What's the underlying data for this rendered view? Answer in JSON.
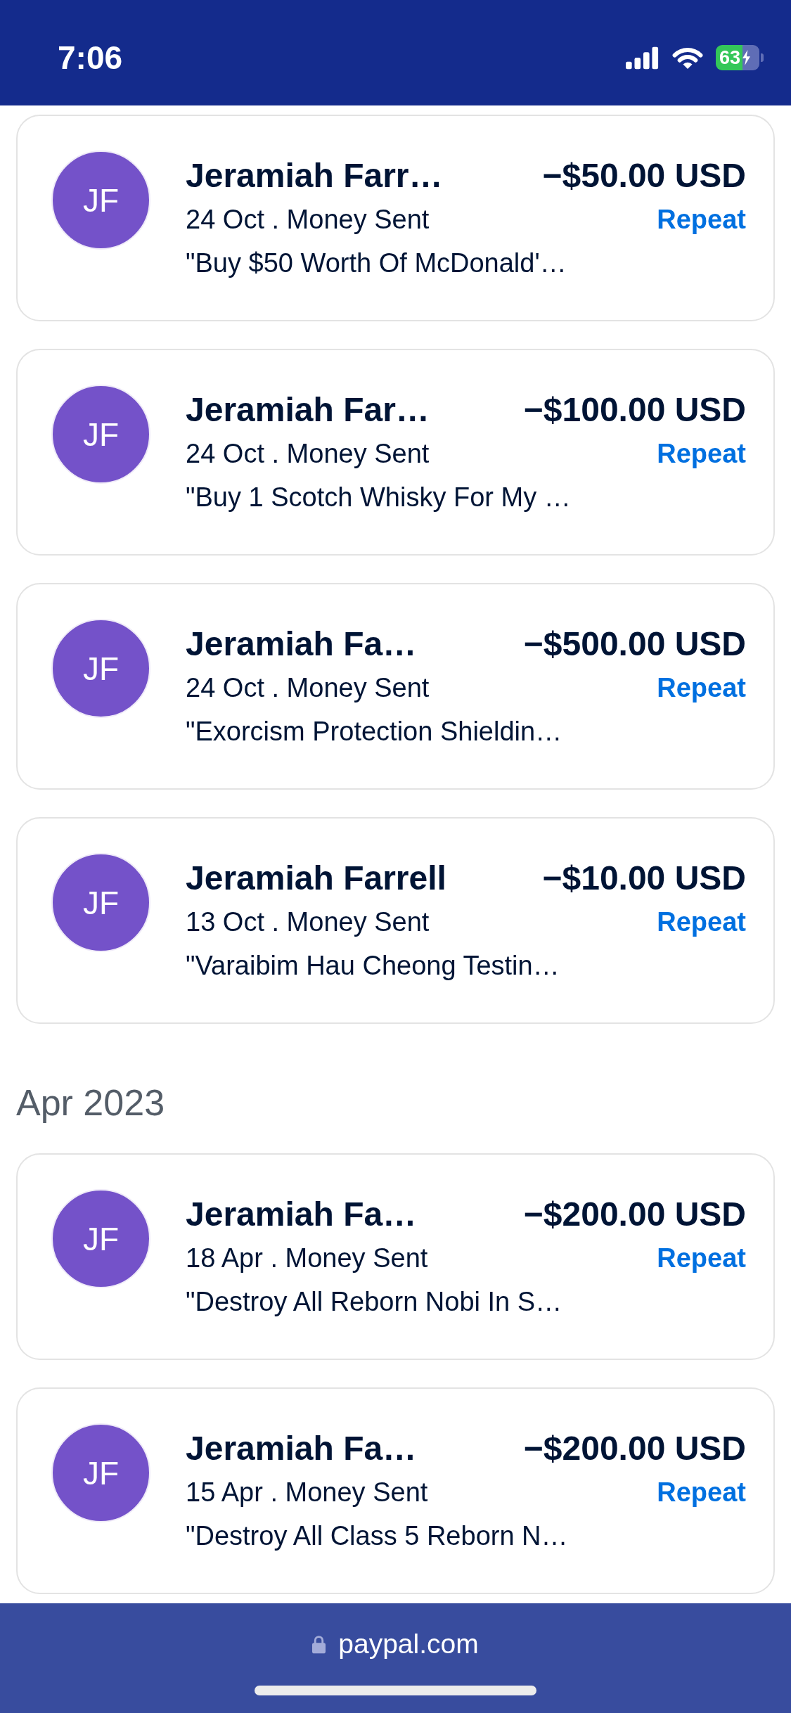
{
  "status_bar": {
    "time": "7:06",
    "battery": "63"
  },
  "sections": [
    {
      "transactions": [
        {
          "initials": "JF",
          "name": "Jeramiah Farr…",
          "amount": "−$50.00 USD",
          "details": "24 Oct . Money Sent",
          "action": "Repeat",
          "note": "\"Buy $50 Worth Of McDonald'…"
        },
        {
          "initials": "JF",
          "name": "Jeramiah Far…",
          "amount": "−$100.00 USD",
          "details": "24 Oct . Money Sent",
          "action": "Repeat",
          "note": "\"Buy 1 Scotch Whisky For My …"
        },
        {
          "initials": "JF",
          "name": "Jeramiah Fa…",
          "amount": "−$500.00 USD",
          "details": "24 Oct . Money Sent",
          "action": "Repeat",
          "note": "\"Exorcism Protection Shieldin…"
        },
        {
          "initials": "JF",
          "name": "Jeramiah Farrell",
          "amount": "−$10.00 USD",
          "details": "13 Oct . Money Sent",
          "action": "Repeat",
          "note": "\"Varaibim Hau Cheong Testin…"
        }
      ]
    },
    {
      "heading": "Apr 2023",
      "transactions": [
        {
          "initials": "JF",
          "name": "Jeramiah Fa…",
          "amount": "−$200.00 USD",
          "details": "18 Apr . Money Sent",
          "action": "Repeat",
          "note": "\"Destroy All Reborn Nobi In S…"
        },
        {
          "initials": "JF",
          "name": "Jeramiah Fa…",
          "amount": "−$200.00 USD",
          "details": "15 Apr . Money Sent",
          "action": "Repeat",
          "note": "\"Destroy All Class 5 Reborn N…"
        }
      ]
    }
  ],
  "browser_bar": {
    "url": "paypal.com"
  }
}
